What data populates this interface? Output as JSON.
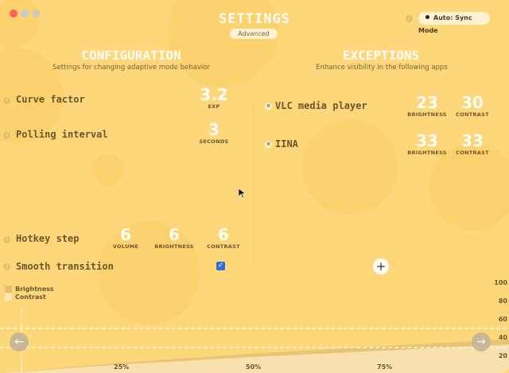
{
  "window": {
    "title": "SETTINGS",
    "mode_pill": "Advanced",
    "sync_label": "Auto: Sync Mode",
    "traffic_colors": [
      "#fe5f57",
      "#c9c9c9",
      "#c9c9c9"
    ]
  },
  "configuration": {
    "title": "CONFIGURATION",
    "subtitle": "Settings for changing adaptive mode behavior",
    "curve_factor": {
      "label": "Curve factor",
      "value": "3.2",
      "unit": "EXP"
    },
    "polling_interval": {
      "label": "Polling interval",
      "value": "3",
      "unit": "SECONDS"
    },
    "hotkey_step": {
      "label": "Hotkey step",
      "volume": {
        "value": "6",
        "unit": "VOLUME"
      },
      "brightness": {
        "value": "6",
        "unit": "BRIGHTNESS"
      },
      "contrast": {
        "value": "6",
        "unit": "CONTRAST"
      }
    },
    "smooth_transition": {
      "label": "Smooth transition",
      "checked": true
    }
  },
  "exceptions": {
    "title": "EXCEPTIONS",
    "subtitle": "Enhance visibility in the following apps",
    "apps": [
      {
        "name": "VLC media player",
        "brightness": "23",
        "brightness_unit": "BRIGHTNESS",
        "contrast": "30",
        "contrast_unit": "CONTRAST"
      },
      {
        "name": "IINA",
        "brightness": "33",
        "brightness_unit": "BRIGHTNESS",
        "contrast": "33",
        "contrast_unit": "CONTRAST"
      }
    ]
  },
  "chart": {
    "legend": {
      "brightness": "Brightness",
      "contrast": "Contrast"
    },
    "y_ticks": [
      "100",
      "80",
      "60",
      "40",
      "20"
    ],
    "x_ticks": [
      "25%",
      "50%",
      "75%"
    ]
  },
  "chart_data": {
    "type": "area",
    "x": [
      0,
      25,
      50,
      75,
      100
    ],
    "series": [
      {
        "name": "Brightness",
        "values": [
          0,
          12,
          22,
          30,
          38
        ]
      },
      {
        "name": "Contrast",
        "values": [
          0,
          10,
          18,
          25,
          32
        ]
      }
    ],
    "ylim": [
      0,
      100
    ],
    "legend_position": "top-left"
  },
  "icons": {
    "info": "info-icon",
    "remove": "remove-icon",
    "add": "plus-icon",
    "check": "checkmark-icon",
    "prev": "arrow-left-icon",
    "next": "arrow-right-icon",
    "info_glyph": "i",
    "remove_glyph": "×",
    "add_glyph": "+",
    "check_glyph": "✓",
    "prev_glyph": "←",
    "next_glyph": "→"
  }
}
